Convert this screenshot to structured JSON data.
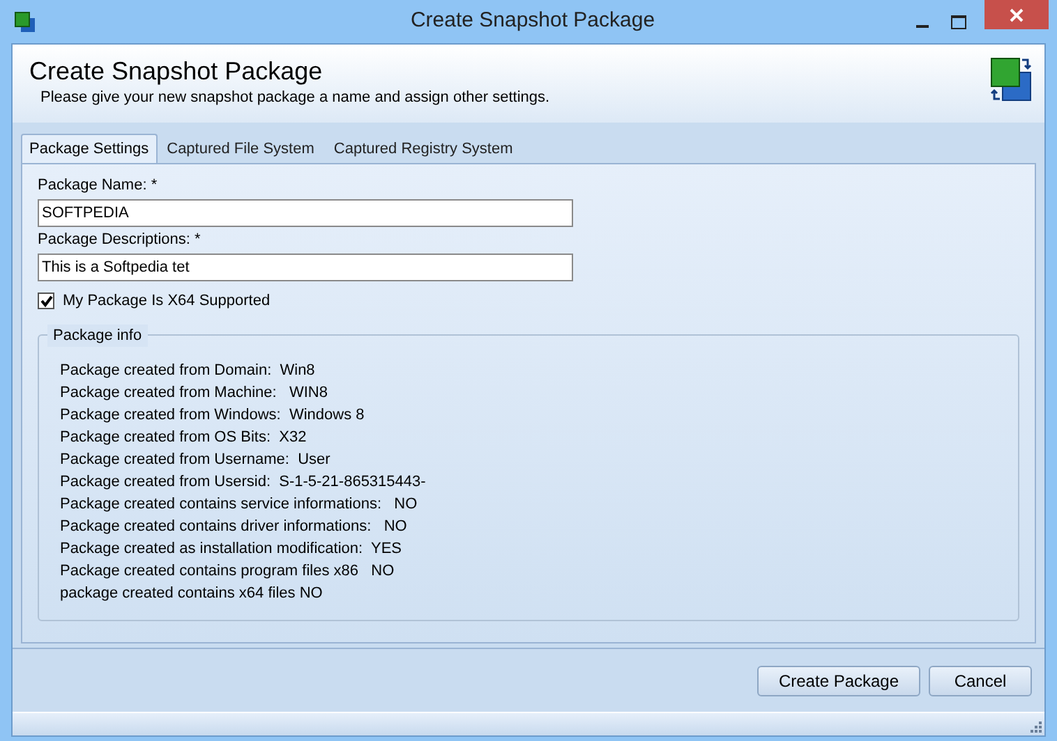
{
  "window": {
    "title": "Create Snapshot Package"
  },
  "header": {
    "title": "Create Snapshot Package",
    "subtitle": "Please give your new snapshot package a name and assign other settings."
  },
  "tabs": [
    {
      "label": "Package Settings",
      "selected": true
    },
    {
      "label": "Captured File System",
      "selected": false
    },
    {
      "label": "Captured Registry System",
      "selected": false
    }
  ],
  "fields": [
    {
      "label": "Package Name: *",
      "value": "SOFTPEDIA"
    },
    {
      "label": "Package Descriptions: *",
      "value": "This is a Softpedia tet"
    }
  ],
  "x64_checkbox": {
    "label": "My Package Is X64 Supported",
    "checked": true
  },
  "package_info": {
    "title": "Package info",
    "lines": [
      "Package created from Domain:  Win8",
      "Package created from Machine:   WIN8",
      "Package created from Windows:  Windows 8",
      "Package created from OS Bits:  X32",
      "Package created from Username:  User",
      "Package created from Usersid:  S-1-5-21-865315443-",
      "Package created contains service informations:   NO",
      "Package created contains driver informations:   NO",
      "Package created as installation modification:  YES",
      "Package created contains program files x86   NO",
      "package created contains x64 files NO"
    ]
  },
  "buttons": [
    "Create Package",
    "Cancel"
  ]
}
